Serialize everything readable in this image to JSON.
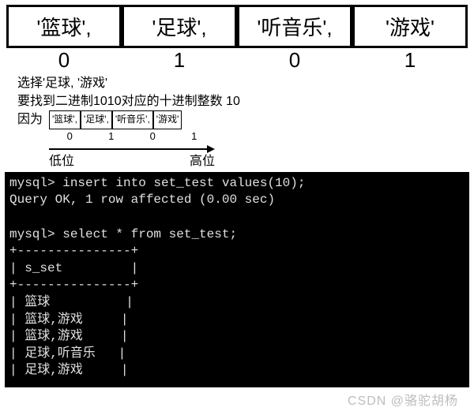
{
  "big_table": {
    "cells": [
      "'篮球',",
      "'足球',",
      "'听音乐',",
      "'游戏'"
    ],
    "indices": [
      "0",
      "1",
      "0",
      "1"
    ]
  },
  "explain": {
    "line1": "选择'足球, '游戏'",
    "line2": "要找到二进制1010对应的十进制整数 10",
    "line3_prefix": "因为"
  },
  "small_table": {
    "cells": [
      "'篮球',",
      "'足球',",
      "'听音乐',",
      "'游戏'"
    ],
    "indices": [
      "0",
      "1",
      "0",
      "1"
    ],
    "low_label": "低位",
    "high_label": "高位"
  },
  "terminal_lines": [
    "mysql> insert into set_test values(10);",
    "Query OK, 1 row affected (0.00 sec)",
    "",
    "mysql> select * from set_test;",
    "+---------------+",
    "| s_set         |",
    "+---------------+",
    "| 篮球          |",
    "| 篮球,游戏     |",
    "| 篮球,游戏     |",
    "| 足球,听音乐   |",
    "| 足球,游戏     |"
  ],
  "watermark": "CSDN @骆驼胡杨"
}
